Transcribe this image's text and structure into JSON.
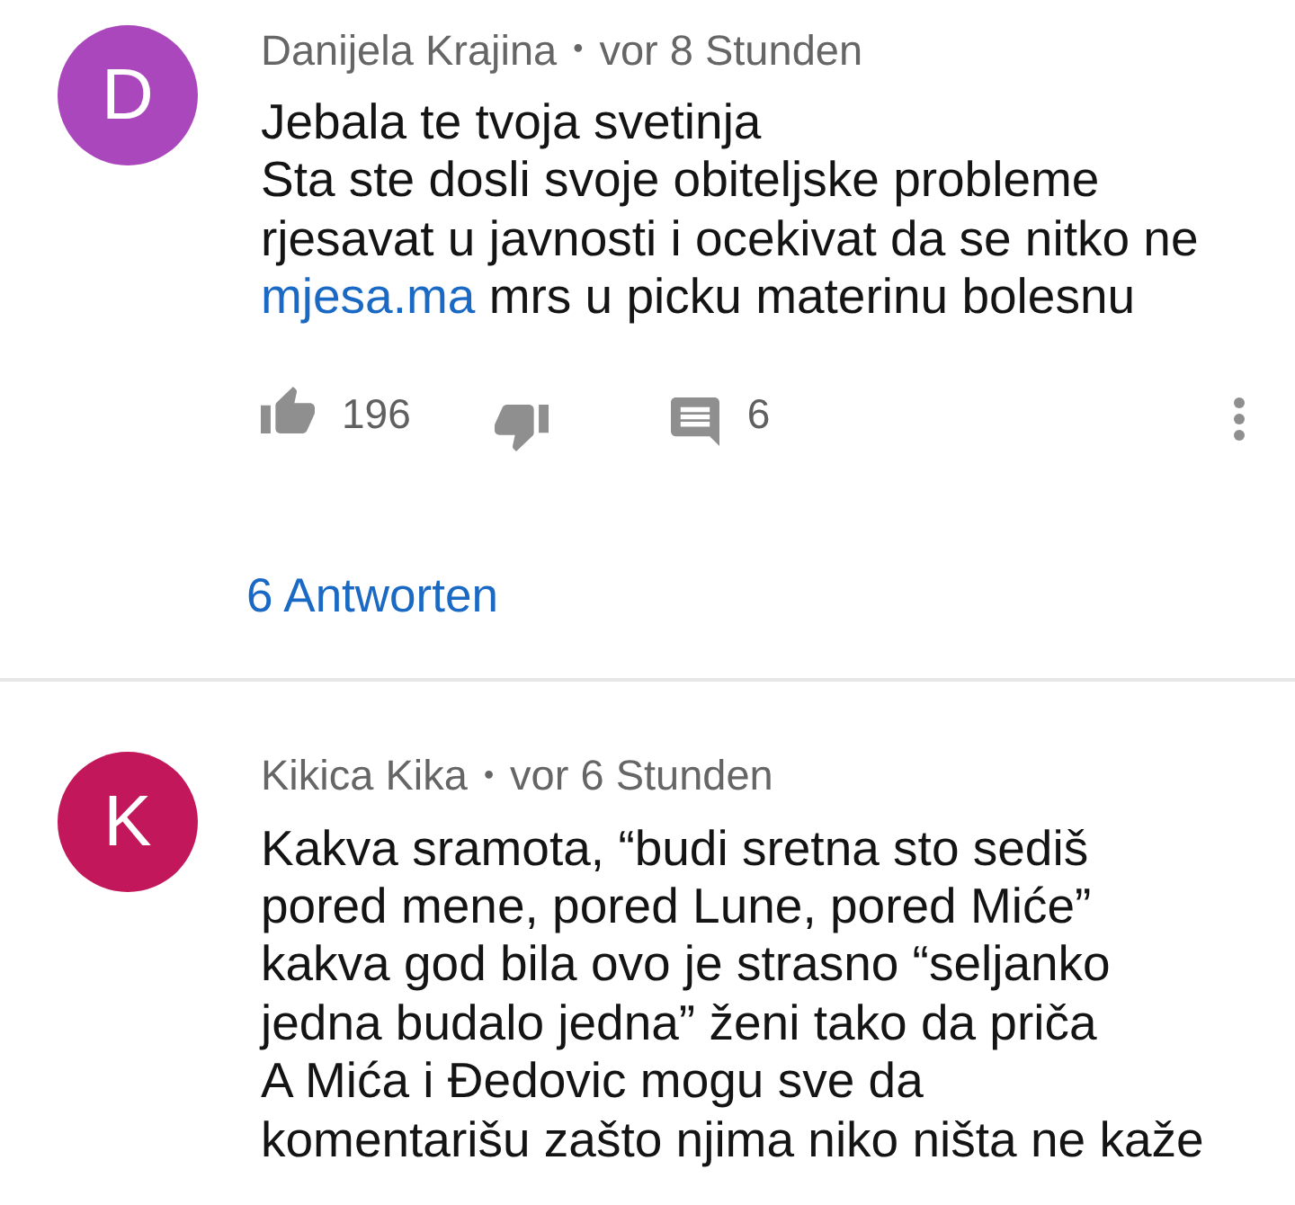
{
  "comments": [
    {
      "avatar": {
        "letter": "D",
        "color": "#ab47bc"
      },
      "author": "Danijela Krajina",
      "separator": "•",
      "time": "vor 8 Stunden",
      "body": [
        {
          "kind": "text",
          "text": "Jebala te tvoja svetinja\nSta ste dosli svoje obiteljske probleme\nrjesavat u javnosti i ocekivat da se nitko ne\n"
        },
        {
          "kind": "link",
          "text": "mjesa.ma"
        },
        {
          "kind": "text",
          "text": " mrs u picku materinu bolesnu"
        }
      ],
      "likes": "196",
      "replies_count": "6",
      "replies_link": "6 Antworten"
    },
    {
      "avatar": {
        "letter": "K",
        "color": "#c2185b"
      },
      "author": "Kikica Kika",
      "separator": "•",
      "time": "vor 6 Stunden",
      "body": [
        {
          "kind": "text",
          "text": "Kakva sramota, “budi sretna sto sediš\npored mene, pored Lune, pored Miće”\nkakva god bila ovo je strasno “seljanko\njedna budalo jedna” ženi tako da priča\nA Mića i Đedovic mogu sve da\nkomentarišu zašto njima niko ništa ne kaže"
        }
      ]
    }
  ]
}
